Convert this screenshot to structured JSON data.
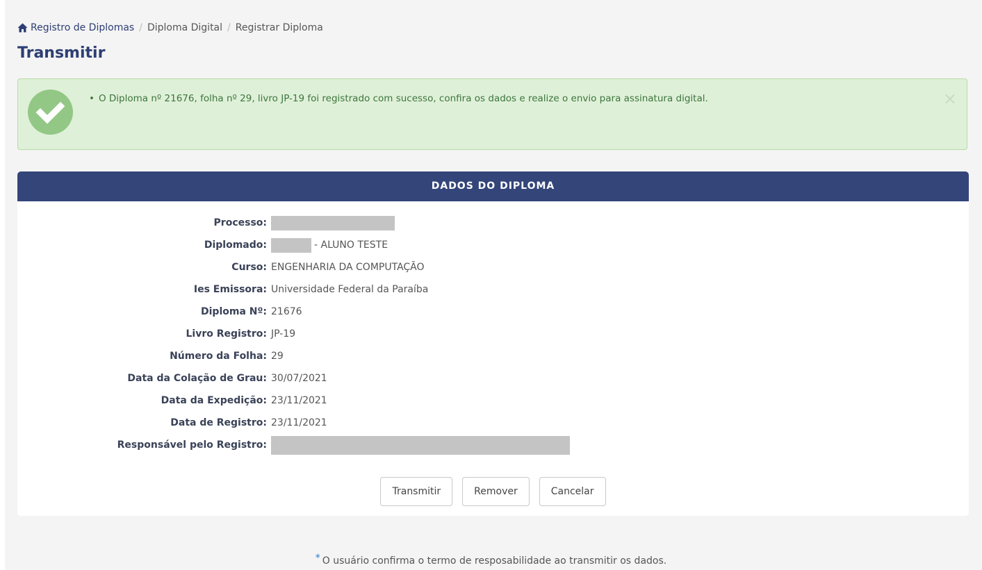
{
  "breadcrumb": {
    "items": [
      "Registro de Diplomas",
      "Diploma Digital",
      "Registrar Diploma"
    ],
    "separator": "/"
  },
  "page": {
    "title": "Transmitir"
  },
  "alert": {
    "message": "O Diploma nº 21676, folha nº 29, livro JP-19 foi registrado com sucesso, confira os dados e realize o envio para assinatura digital.",
    "bullet": "•",
    "close_label": "×",
    "icon": "check-circle-icon",
    "color": "#dff0d8"
  },
  "panel": {
    "title": "DADOS DO DIPLOMA",
    "header_color": "#34457a",
    "fields": {
      "processo": {
        "label": "Processo:",
        "value": ""
      },
      "diplomado": {
        "label": "Diplomado:",
        "value": "- ALUNO TESTE"
      },
      "curso": {
        "label": "Curso:",
        "value": "ENGENHARIA DA COMPUTAÇÃO"
      },
      "ies": {
        "label": "Ies Emissora:",
        "value": "Universidade Federal da Paraíba"
      },
      "diploma_no": {
        "label": "Diploma Nº:",
        "value": "21676"
      },
      "livro": {
        "label": "Livro Registro:",
        "value": "JP-19"
      },
      "folha": {
        "label": "Número da Folha:",
        "value": "29"
      },
      "colacao": {
        "label": "Data da Colação de Grau:",
        "value": "30/07/2021"
      },
      "expedicao": {
        "label": "Data da Expedição:",
        "value": "23/11/2021"
      },
      "registro": {
        "label": "Data de Registro:",
        "value": "23/11/2021"
      },
      "responsavel": {
        "label": "Responsável pelo Registro:",
        "value": ""
      }
    }
  },
  "buttons": {
    "transmitir": "Transmitir",
    "remover": "Remover",
    "cancelar": "Cancelar"
  },
  "footer": {
    "star": "*",
    "note": "O usuário confirma o termo de resposabilidade ao transmitir os dados."
  }
}
